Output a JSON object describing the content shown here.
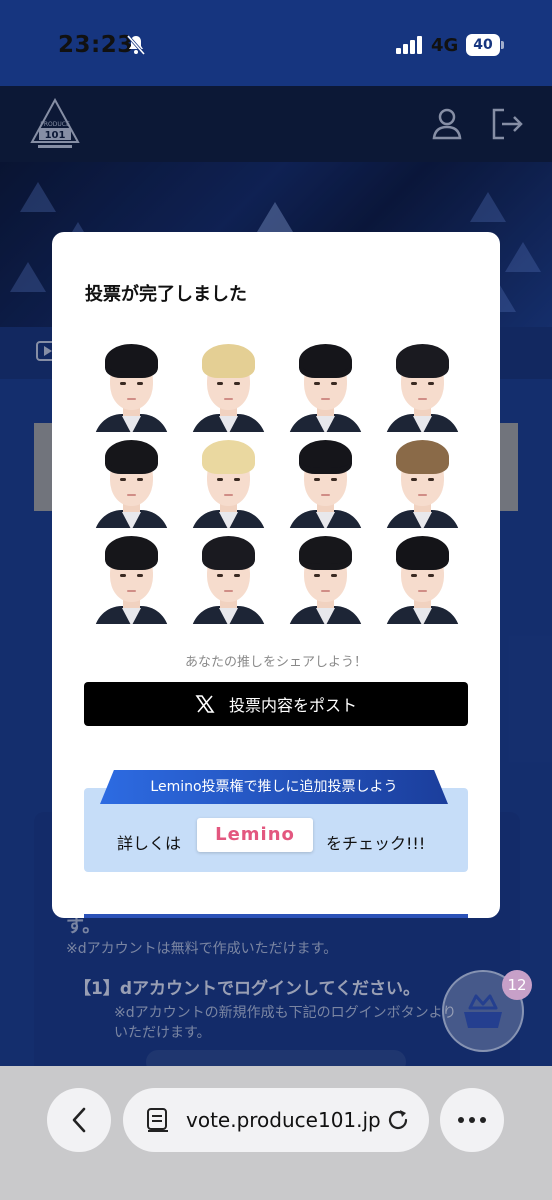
{
  "status_bar": {
    "time": "23:23",
    "network": "4G",
    "battery": "40"
  },
  "site": {
    "logo_line1": "PRODUCE",
    "logo_line2": "101"
  },
  "background_page": {
    "cut_text": "す。",
    "note1": "※dアカウントは無料で作成いただけます。",
    "step1": "【1】dアカウントでログインしてください。",
    "note2": "※dアカウントの新規作成も下記のログインボタンより",
    "note2b": "いただけます。",
    "badge_count": "12"
  },
  "modal": {
    "title": "投票が完了しました",
    "share_prompt": "あなたの推しをシェアしよう！",
    "post_button": "投票内容をポスト",
    "lemino_ribbon": "Lemino投票権で推しに追加投票しよう",
    "lemino_pre": "詳しくは",
    "lemino_logo": "Lemino",
    "lemino_post": "をチェック!!!",
    "colors": {
      "lemino_brand": "#e3577f",
      "ribbon": "#2d6be2"
    }
  },
  "candidates": [
    {
      "hair": "#15151a"
    },
    {
      "hair": "#e4cf94"
    },
    {
      "hair": "#15151a"
    },
    {
      "hair": "#1a1a20"
    },
    {
      "hair": "#16161a"
    },
    {
      "hair": "#ead8a0"
    },
    {
      "hair": "#15151a"
    },
    {
      "hair": "#8a6a48"
    },
    {
      "hair": "#16161a"
    },
    {
      "hair": "#1a1a20"
    },
    {
      "hair": "#17171b"
    },
    {
      "hair": "#141418"
    }
  ],
  "browser": {
    "url": "vote.produce101.jp"
  }
}
